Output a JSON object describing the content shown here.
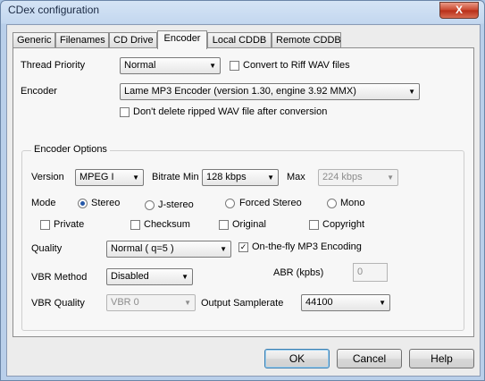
{
  "window": {
    "title": "CDex configuration",
    "close_symbol": "X"
  },
  "tabs": [
    "Generic",
    "Filenames",
    "CD Drive",
    "Encoder",
    "Local CDDB",
    "Remote CDDB"
  ],
  "active_tab": "Encoder",
  "thread_priority": {
    "label": "Thread Priority",
    "value": "Normal"
  },
  "convert_riff": {
    "label": "Convert to Riff WAV files",
    "checked": false
  },
  "encoder": {
    "label": "Encoder",
    "value": "Lame MP3 Encoder (version 1.30, engine 3.92 MMX)"
  },
  "dont_delete": {
    "label": "Don't delete ripped WAV file after conversion",
    "checked": false
  },
  "options": {
    "title": "Encoder Options",
    "version": {
      "label": "Version",
      "value": "MPEG I"
    },
    "bitrate_min": {
      "label": "Bitrate Min",
      "value": "128 kbps"
    },
    "bitrate_max": {
      "label": "Max",
      "value": "224 kbps"
    },
    "mode": {
      "label": "Mode",
      "options": [
        "Stereo",
        "J-stereo",
        "Forced Stereo",
        "Mono"
      ],
      "selected": "Stereo"
    },
    "flags": [
      {
        "label": "Private",
        "checked": false
      },
      {
        "label": "Checksum",
        "checked": false
      },
      {
        "label": "Original",
        "checked": false
      },
      {
        "label": "Copyright",
        "checked": false
      }
    ],
    "quality": {
      "label": "Quality",
      "value": "Normal ( q=5 )"
    },
    "on_the_fly": {
      "label": "On-the-fly MP3 Encoding",
      "checked": true,
      "check_mark": "✓"
    },
    "vbr_method": {
      "label": "VBR Method",
      "value": "Disabled"
    },
    "abr": {
      "label": "ABR (kpbs)",
      "value": "0"
    },
    "vbr_quality": {
      "label": "VBR Quality",
      "value": "VBR 0"
    },
    "output_samplerate": {
      "label": "Output Samplerate",
      "value": "44100"
    }
  },
  "buttons": {
    "ok": "OK",
    "cancel": "Cancel",
    "help": "Help"
  },
  "icons": {
    "dropdown_arrow": "▼"
  }
}
